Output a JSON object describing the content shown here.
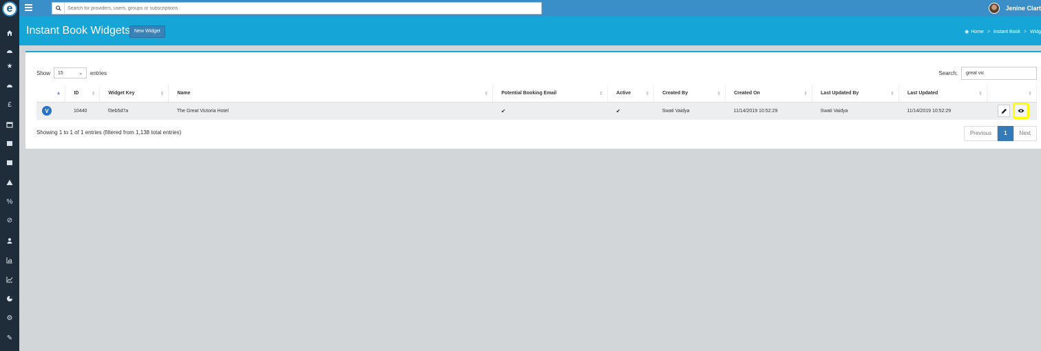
{
  "topbar": {
    "search_placeholder": "Search for providers, users, groups or subscriptions",
    "username": "Jenine Clart"
  },
  "header": {
    "title": "Instant Book Widgets",
    "new_widget_label": "New Widget",
    "breadcrumb": [
      "Home",
      "Instant Book",
      "Widg"
    ]
  },
  "controls": {
    "show_label": "Show",
    "entries_value": "15",
    "entries_label": "entries",
    "search_label": "Search:",
    "search_value": "great vic"
  },
  "table": {
    "columns": [
      "ID",
      "Widget Key",
      "Name",
      "Potential Booking Email",
      "Active",
      "Created By",
      "Created On",
      "Last Updated By",
      "Last Updated"
    ],
    "rows": [
      {
        "badge": "V",
        "id": "10440",
        "widget_key": "f3eb5d7a",
        "name": "The Great Victoria Hotel",
        "potential_booking_email": "✔",
        "active": "✔",
        "created_by": "Swati Vaidya",
        "created_on": "11/14/2019 10:52:29",
        "last_updated_by": "Swati Vaidya",
        "last_updated": "11/14/2019 10:52:29"
      }
    ]
  },
  "footer": {
    "info": "Showing 1 to 1 of 1 entries (filtered from 1,138 total entries)",
    "previous": "Previous",
    "page": "1",
    "next": "Next"
  },
  "colors": {
    "topbar": "#3a8fc8",
    "header": "#15a5d6",
    "sidebar": "#1f2d3a",
    "highlight": "#ffff00"
  },
  "icons": [
    "home-icon",
    "dashboard-icon",
    "star-icon",
    "tachometer-icon",
    "pound-icon",
    "calendar-icon",
    "calendar-icon",
    "calendar-icon",
    "warning-icon",
    "percent-icon",
    "ban-icon",
    "user-icon",
    "chart-bar-icon",
    "chart-line-icon",
    "pie-chart-icon",
    "cogs-icon",
    "pencil-icon"
  ]
}
